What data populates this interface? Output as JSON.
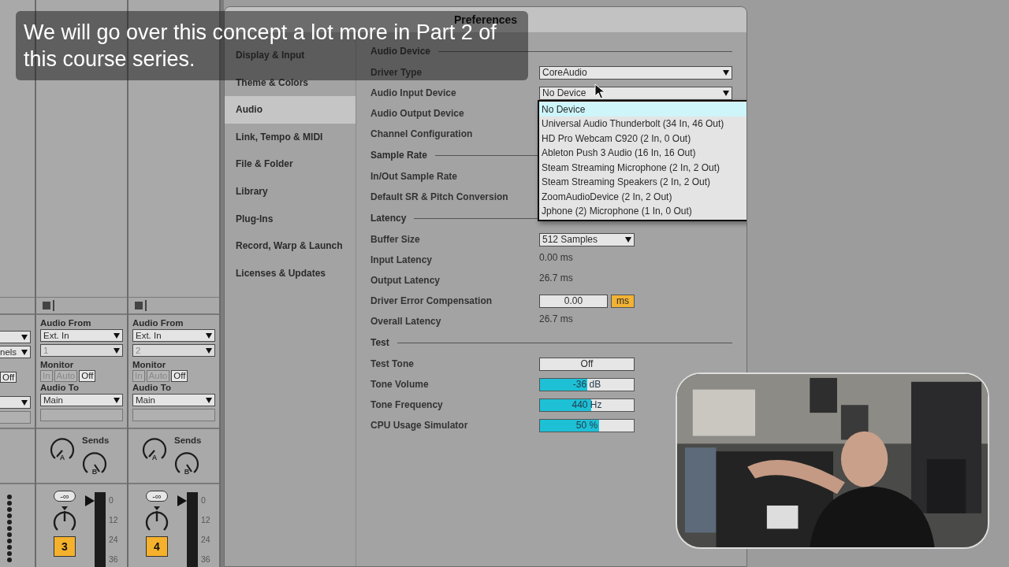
{
  "caption": "We will go over this concept a lot more in Part 2 of this course series.",
  "mixer": {
    "partial_track": {
      "channel_select": "nels",
      "monitor": {
        "label": "Off",
        "selected": true
      }
    },
    "tracks": [
      {
        "audio_from_label": "Audio From",
        "input_type": "Ext. In",
        "input_channel": "1",
        "channel_disabled": true,
        "monitor_label": "Monitor",
        "monitor": [
          {
            "label": "In",
            "selected": false
          },
          {
            "label": "Auto",
            "selected": false
          },
          {
            "label": "Off",
            "selected": true
          }
        ],
        "audio_to_label": "Audio To",
        "output": "Main",
        "sends_label": "Sends",
        "sends": [
          "A",
          "B"
        ],
        "volume": "-∞",
        "number": "3",
        "scale": [
          "0",
          "12",
          "24",
          "36"
        ]
      },
      {
        "audio_from_label": "Audio From",
        "input_type": "Ext. In",
        "input_channel": "2",
        "channel_disabled": true,
        "monitor_label": "Monitor",
        "monitor": [
          {
            "label": "In",
            "selected": false
          },
          {
            "label": "Auto",
            "selected": false
          },
          {
            "label": "Off",
            "selected": true
          }
        ],
        "audio_to_label": "Audio To",
        "output": "Main",
        "sends_label": "Sends",
        "sends": [
          "A",
          "B"
        ],
        "volume": "-∞",
        "number": "4",
        "scale": [
          "0",
          "12",
          "24",
          "36"
        ]
      }
    ]
  },
  "preferences": {
    "title": "Preferences",
    "sidebar": [
      {
        "label": "Display & Input",
        "selected": false
      },
      {
        "label": "Theme & Colors",
        "selected": false
      },
      {
        "label": "Audio",
        "selected": true
      },
      {
        "label": "Link, Tempo & MIDI",
        "selected": false
      },
      {
        "label": "File & Folder",
        "selected": false
      },
      {
        "label": "Library",
        "selected": false
      },
      {
        "label": "Plug-Ins",
        "selected": false
      },
      {
        "label": "Record, Warp & Launch",
        "selected": false
      },
      {
        "label": "Licenses & Updates",
        "selected": false
      }
    ],
    "sections": [
      {
        "title": "Audio Device",
        "rows": [
          {
            "label": "Driver Type",
            "kind": "wide_select",
            "value": "CoreAudio"
          },
          {
            "label": "Audio Input Device",
            "kind": "wide_select",
            "value": "No Device",
            "menu": {
              "options": [
                {
                  "label": "No Device",
                  "selected": true
                },
                {
                  "label": "Universal Audio Thunderbolt (34 In, 46 Out)",
                  "selected": false
                },
                {
                  "label": "HD Pro Webcam C920 (2 In, 0 Out)",
                  "selected": false
                },
                {
                  "label": "Ableton Push 3 Audio (16 In, 16 Out)",
                  "selected": false
                },
                {
                  "label": "Steam Streaming Microphone (2 In, 2 Out)",
                  "selected": false
                },
                {
                  "label": "Steam Streaming Speakers (2 In, 2 Out)",
                  "selected": false
                },
                {
                  "label": "ZoomAudioDevice (2 In, 2 Out)",
                  "selected": false
                },
                {
                  "label": "Jphone (2) Microphone (1 In, 0 Out)",
                  "selected": false
                }
              ]
            }
          },
          {
            "label": "Audio Output Device",
            "kind": "hidden"
          },
          {
            "label": "Channel Configuration",
            "kind": "hidden"
          }
        ]
      },
      {
        "title": "Sample Rate",
        "rows": [
          {
            "label": "In/Out Sample Rate",
            "kind": "hidden"
          },
          {
            "label": "Default SR & Pitch Conversion",
            "kind": "hidden"
          }
        ]
      },
      {
        "title": "Latency",
        "rows": [
          {
            "label": "Buffer Size",
            "kind": "select",
            "value": "512 Samples"
          },
          {
            "label": "Input Latency",
            "kind": "text",
            "value": "0.00 ms"
          },
          {
            "label": "Output Latency",
            "kind": "text",
            "value": "26.7 ms"
          },
          {
            "label": "Driver Error Compensation",
            "kind": "number",
            "value": "0.00",
            "unit": "ms"
          },
          {
            "label": "Overall Latency",
            "kind": "text",
            "value": "26.7 ms"
          }
        ]
      },
      {
        "title": "Test",
        "rows": [
          {
            "label": "Test Tone",
            "kind": "toggle",
            "value": "Off",
            "on": false
          },
          {
            "label": "Tone Volume",
            "kind": "slider",
            "value": "-36 dB",
            "level": 0.5
          },
          {
            "label": "Tone Frequency",
            "kind": "slider",
            "value": "440 Hz",
            "level": 0.55
          },
          {
            "label": "CPU Usage Simulator",
            "kind": "slider",
            "value": "50 %",
            "level": 0.63
          }
        ]
      }
    ]
  }
}
